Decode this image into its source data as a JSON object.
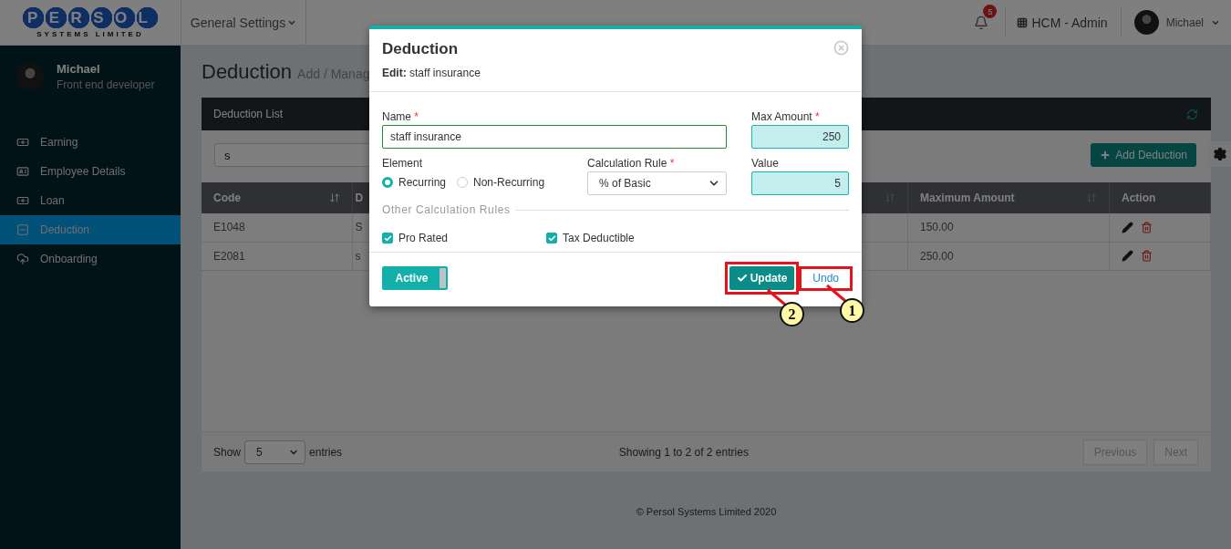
{
  "logo": {
    "letters": "PERSOL",
    "tagline": "SYSTEMS LIMITED"
  },
  "header": {
    "menu": "General Settings",
    "notifications": "5",
    "app": "HCM - Admin",
    "user": "Michael"
  },
  "sidebar": {
    "profile": {
      "name": "Michael",
      "role": "Front end developer"
    },
    "items": [
      {
        "label": "Earning",
        "selected": false
      },
      {
        "label": "Employee Details",
        "selected": false
      },
      {
        "label": "Loan",
        "selected": false
      },
      {
        "label": "Deduction",
        "selected": true
      },
      {
        "label": "Onboarding",
        "selected": false
      }
    ]
  },
  "page": {
    "title": "Deduction",
    "subtitle": "Add / Manag"
  },
  "card": {
    "title": "Deduction List",
    "search": {
      "value": "s"
    },
    "add_button": "Add Deduction",
    "table": {
      "columns": [
        {
          "label": "Code",
          "sorted": true
        },
        {
          "label": "D",
          "sorted": false
        },
        {
          "label": "Maximum Amount",
          "sorted": false
        },
        {
          "label": "Action"
        }
      ],
      "rows": [
        [
          "E1048",
          "S",
          "150.00"
        ],
        [
          "E2081",
          "s",
          "250.00"
        ]
      ]
    },
    "footer": {
      "show_label": "Show",
      "page_size": "5",
      "entries_label": "entries",
      "info": "Showing 1 to 2 of 2 entries",
      "buttons": [
        {
          "label": "Previous",
          "disabled": true
        },
        {
          "label": "Next",
          "disabled": true
        }
      ]
    }
  },
  "footer": "© Persol Systems Limited 2020",
  "modal": {
    "title": "Deduction",
    "edit_label": "Edit:",
    "edit_value": "staff insurance",
    "name_field": {
      "label": "Name",
      "marker": "*",
      "value": "staff insurance"
    },
    "max_amount": {
      "label": "Max Amount",
      "marker": "*",
      "value": "250"
    },
    "element": {
      "label": "Element",
      "options": [
        {
          "label": "Recurring",
          "selected": true
        },
        {
          "label": "Non-Recurring",
          "selected": false
        }
      ]
    },
    "calculation_rule": {
      "label": "Calculation Rule",
      "marker": "*",
      "value": "% of Basic"
    },
    "value_field": {
      "label": "Value",
      "value": "5"
    },
    "other_rules": {
      "label": "Other Calculation Rules",
      "options": [
        {
          "label": "Pro Rated",
          "checked": true
        },
        {
          "label": "Tax Deductible",
          "checked": true
        }
      ]
    },
    "active_toggle": {
      "label": "Active",
      "on": true
    },
    "update_button": "Update",
    "undo_button": "Undo"
  },
  "callouts": [
    {
      "number": "2"
    },
    {
      "number": "1"
    }
  ]
}
